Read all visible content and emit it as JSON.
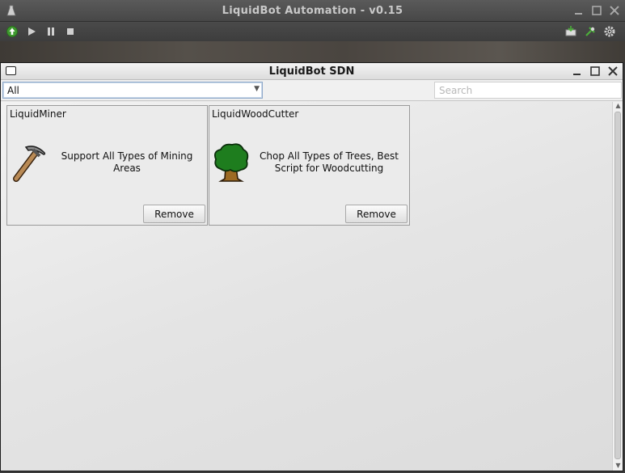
{
  "main_window": {
    "title": "LiquidBot Automation - v0.15",
    "toolbar": {
      "left_icons": [
        "update-icon",
        "play-icon",
        "pause-icon",
        "stop-icon"
      ],
      "right_icons": [
        "input-icon",
        "plugin-icon",
        "settings-icon"
      ]
    }
  },
  "sdn_window": {
    "title": "LiquidBot SDN",
    "filter": {
      "selected": "All"
    },
    "search": {
      "placeholder": "Search",
      "value": ""
    },
    "scripts": [
      {
        "name": "LiquidMiner",
        "icon": "pickaxe-icon",
        "description": "Support All Types of Mining Areas",
        "button_label": "Remove"
      },
      {
        "name": "LiquidWoodCutter",
        "icon": "tree-icon",
        "description": "Chop All Types of Trees, Best Script for Woodcutting",
        "button_label": "Remove"
      }
    ]
  },
  "colors": {
    "selection_border": "#8fa9c9",
    "toolbar_green": "#4caf3a",
    "tree_green": "#1e7d1e",
    "trunk_brown": "#8a5a1e"
  }
}
